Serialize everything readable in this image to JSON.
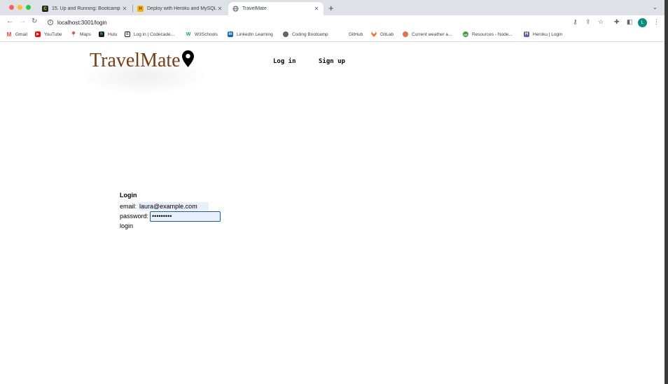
{
  "browser": {
    "tabs": [
      {
        "title": "15. Up and Running: Bootcamp",
        "icon": "codecademy-favicon"
      },
      {
        "title": "Deploy with Heroku and MySQL",
        "icon": "heroku-favicon"
      },
      {
        "title": "TravelMate",
        "icon": "globe-icon",
        "active": true
      }
    ],
    "url": "localhost:3001/login",
    "bookmarks": [
      {
        "label": "Gmail",
        "color": "#ea4335"
      },
      {
        "label": "YouTube",
        "color": "#ff0000"
      },
      {
        "label": "Maps",
        "color": "#34a853"
      },
      {
        "label": "Hulu",
        "color": "#1a1a1a"
      },
      {
        "label": "Log in | Codecade...",
        "color": "#1f1f1f"
      },
      {
        "label": "W3Schools",
        "color": "#04aa6d"
      },
      {
        "label": "LinkedIn Learning",
        "color": "#0a66c2"
      },
      {
        "label": "Coding Bootcamp",
        "color": "#5f6368"
      },
      {
        "label": "GitHub",
        "color": "#ffffff"
      },
      {
        "label": "GitLab",
        "color": "#fc6d26"
      },
      {
        "label": "Current weather a...",
        "color": "#eb6e4b"
      },
      {
        "label": "Resources - Node...",
        "color": "#43a047"
      },
      {
        "label": "Heroku | Login",
        "color": "#79589f"
      }
    ],
    "avatar_letter": "L"
  },
  "site": {
    "brand": "TravelMate",
    "brand_color": "#7a3d14",
    "nav": {
      "login": "Log in",
      "signup": "Sign up"
    }
  },
  "login_form": {
    "title": "Login",
    "email_label": "email:",
    "email_value": "laura@example.com",
    "password_label": "password:",
    "password_value": "password1",
    "submit_label": "login"
  }
}
